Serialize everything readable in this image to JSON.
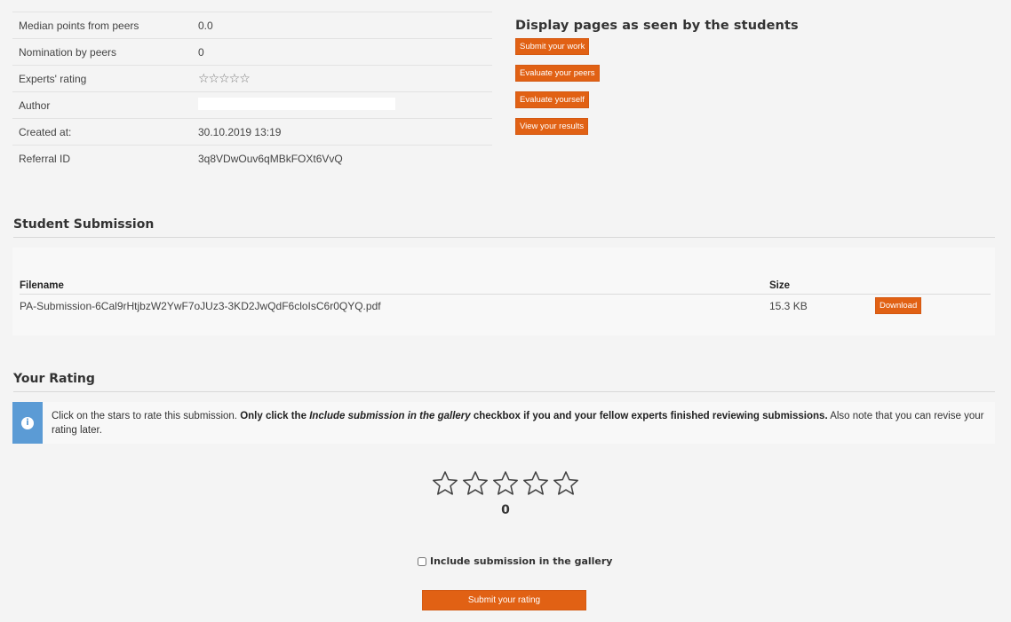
{
  "details": {
    "rows": [
      {
        "label": "Median points from peers",
        "value": "0.0"
      },
      {
        "label": "Nomination by peers",
        "value": "0"
      },
      {
        "label": "Experts' rating",
        "value": "☆☆☆☆☆"
      },
      {
        "label": "Author",
        "value": ""
      },
      {
        "label": "Created at:",
        "value": "30.10.2019 13:19"
      },
      {
        "label": "Referral ID",
        "value": "3q8VDwOuv6qMBkFOXt6VvQ"
      }
    ]
  },
  "preview": {
    "title": "Display pages as seen by the students",
    "buttons": [
      "Submit your work",
      "Evaluate your peers",
      "Evaluate yourself",
      "View your results"
    ]
  },
  "submission": {
    "title": "Student Submission",
    "headers": {
      "filename": "Filename",
      "size": "Size"
    },
    "files": [
      {
        "filename": "PA-Submission-6Cal9rHtjbzW2YwF7oJUz3-3KD2JwQdF6cloIsC6r0QYQ.pdf",
        "size": "15.3 KB",
        "action": "Download"
      }
    ]
  },
  "rating": {
    "title": "Your Rating",
    "notice": {
      "part1": "Click on the stars to rate this submission. ",
      "bold1": "Only click the ",
      "bold_italic": "Include submission in the gallery",
      "bold2": " checkbox if you and your fellow experts finished reviewing submissions.",
      "part2": " Also note that you can revise your rating later."
    },
    "stars_total": 5,
    "value": "0",
    "gallery_label": "Include submission in the gallery",
    "gallery_checked": false,
    "submit_label": "Submit your rating"
  },
  "colors": {
    "accent": "#e16114",
    "info": "#5b9bd5"
  }
}
